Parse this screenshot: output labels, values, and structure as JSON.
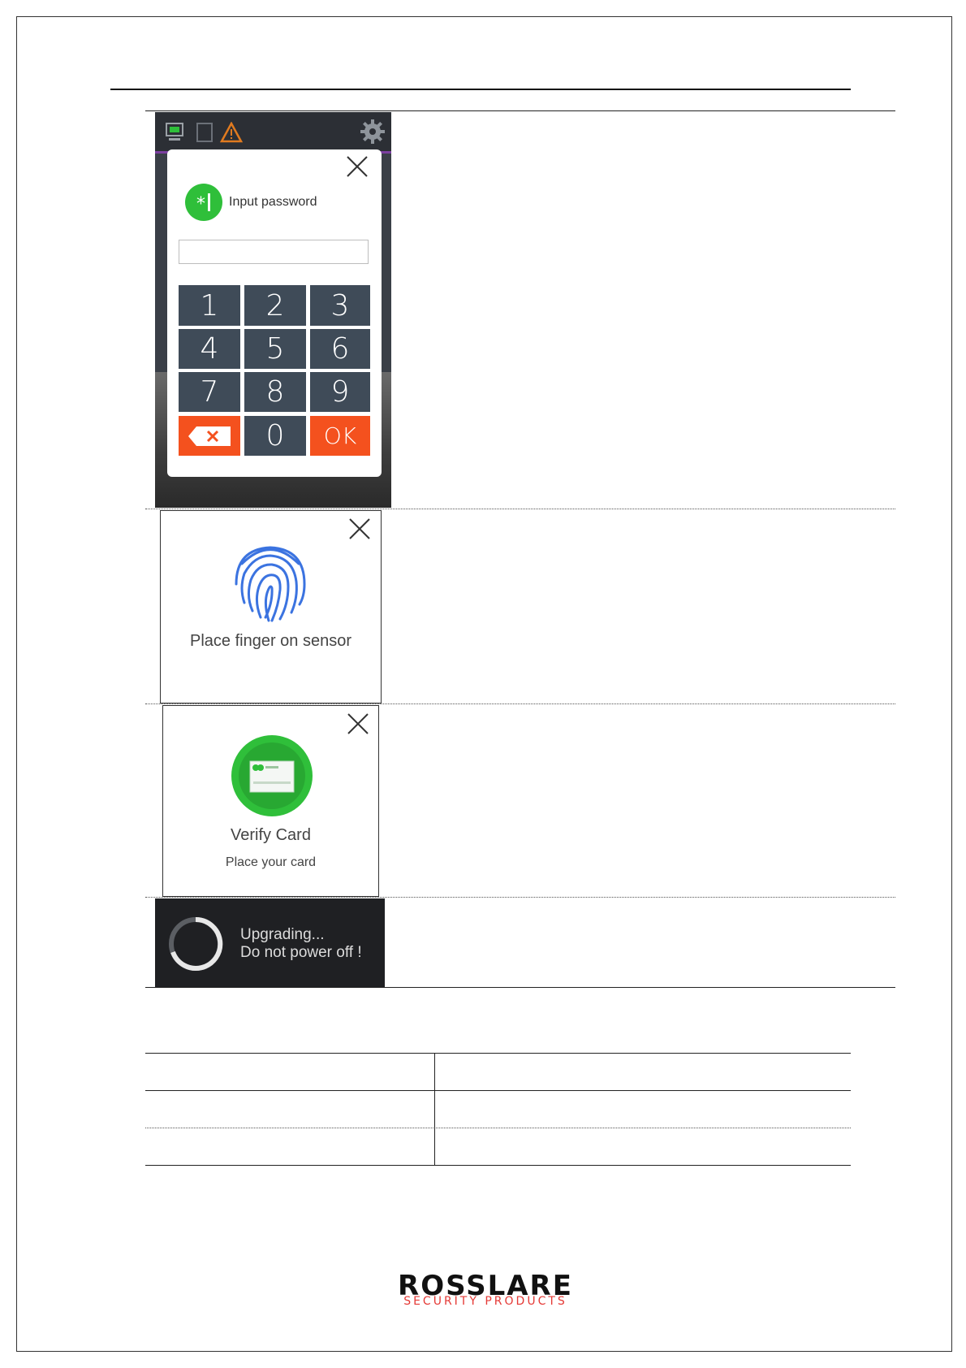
{
  "password_dialog": {
    "title": "Input password",
    "keys": [
      "1",
      "2",
      "3",
      "4",
      "5",
      "6",
      "7",
      "8",
      "9",
      "0"
    ],
    "ok_label": "OK",
    "field_value": ""
  },
  "fingerprint_dialog": {
    "message": "Place finger on sensor"
  },
  "card_dialog": {
    "title": "Verify Card",
    "subtitle": "Place your card"
  },
  "upgrade_notice": {
    "line1": "Upgrading...",
    "line2": "Do not power off !"
  },
  "footer": {
    "logo_main": "ROSSLARE",
    "logo_sub": "SECURITY PRODUCTS"
  },
  "colors": {
    "key_bg": "#3f4b58",
    "accent_orange": "#f4511e",
    "accent_green": "#2fbf3a",
    "brand_red": "#e53935"
  }
}
